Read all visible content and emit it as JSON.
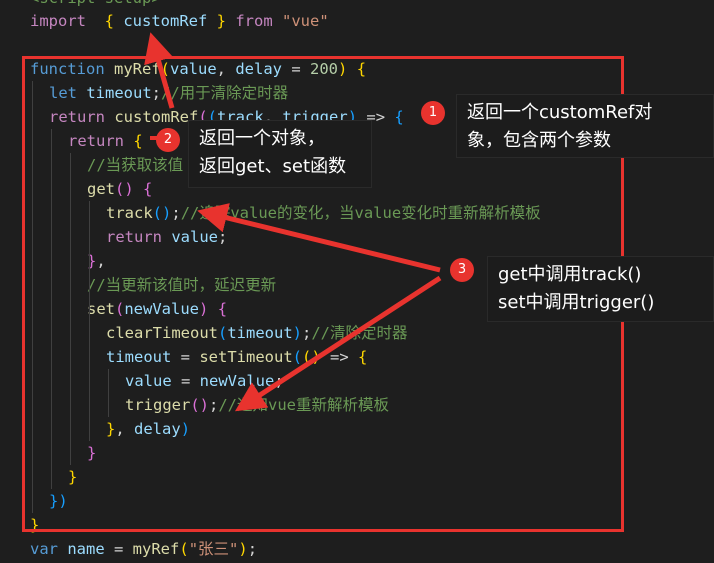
{
  "code": {
    "lines": [
      {
        "tokens": [
          [
            "cm",
            "<script setup>"
          ]
        ]
      },
      {
        "tokens": [
          [
            "kw2",
            "import"
          ],
          [
            "",
            "  "
          ],
          [
            "br1",
            "{"
          ],
          [
            "",
            ""
          ],
          [
            "var",
            " customRef"
          ],
          [
            "",
            ""
          ],
          [
            "br1",
            " }"
          ],
          [
            "kw2",
            " from"
          ],
          [
            "str",
            " \"vue\""
          ]
        ]
      },
      {
        "tokens": []
      },
      {
        "tokens": [
          [
            "kw",
            "function"
          ],
          [
            "fn",
            " myRef"
          ],
          [
            "br1",
            "("
          ],
          [
            "var",
            "value"
          ],
          [
            "",
            ", "
          ],
          [
            "var",
            "delay"
          ],
          [
            "",
            " = "
          ],
          [
            "num",
            "200"
          ],
          [
            "br1",
            ")"
          ],
          [
            "",
            " "
          ],
          [
            "br1",
            "{"
          ]
        ]
      },
      {
        "tokens": [
          [
            "kw",
            "let"
          ],
          [
            "var",
            " timeout"
          ],
          [
            "",
            ";"
          ],
          [
            "cm",
            "//用于清除定时器"
          ]
        ]
      },
      {
        "tokens": [
          [
            "kw2",
            "return"
          ],
          [
            "fn",
            " customRef"
          ],
          [
            "br2",
            "("
          ],
          [
            "br3",
            "("
          ],
          [
            "var",
            "track"
          ],
          [
            "",
            ", "
          ],
          [
            "var",
            "trigger"
          ],
          [
            "br3",
            ")"
          ],
          [
            "",
            " => "
          ],
          [
            "br3",
            "{"
          ]
        ]
      },
      {
        "tokens": [
          [
            "kw2",
            "return"
          ],
          [
            "",
            " "
          ],
          [
            "br1",
            "{"
          ]
        ]
      },
      {
        "tokens": [
          [
            "cm",
            "//当获取该值"
          ]
        ]
      },
      {
        "tokens": [
          [
            "fn",
            "get"
          ],
          [
            "br2",
            "()"
          ],
          [
            "",
            " "
          ],
          [
            "br2",
            "{"
          ]
        ]
      },
      {
        "tokens": [
          [
            "fn",
            "track"
          ],
          [
            "br3",
            "()"
          ],
          [
            "",
            ";"
          ],
          [
            "cm",
            "//追踪value的变化，当value变化时重新解析模板"
          ]
        ]
      },
      {
        "tokens": [
          [
            "kw2",
            "return"
          ],
          [
            "var",
            " value"
          ],
          [
            "",
            ";"
          ]
        ]
      },
      {
        "tokens": [
          [
            "br2",
            "}"
          ],
          [
            "",
            ","
          ]
        ]
      },
      {
        "tokens": [
          [
            "cm",
            "//当更新该值时，延迟更新"
          ]
        ]
      },
      {
        "tokens": [
          [
            "fn",
            "set"
          ],
          [
            "br2",
            "("
          ],
          [
            "var",
            "newValue"
          ],
          [
            "br2",
            ")"
          ],
          [
            "",
            " "
          ],
          [
            "br2",
            "{"
          ]
        ]
      },
      {
        "tokens": [
          [
            "fn",
            "clearTimeout"
          ],
          [
            "br3",
            "("
          ],
          [
            "var",
            "timeout"
          ],
          [
            "br3",
            ")"
          ],
          [
            "",
            ";"
          ],
          [
            "cm",
            "//清除定时器"
          ]
        ]
      },
      {
        "tokens": [
          [
            "var",
            "timeout"
          ],
          [
            "",
            " = "
          ],
          [
            "fn",
            "setTimeout"
          ],
          [
            "br3",
            "("
          ],
          [
            "br1",
            "()"
          ],
          [
            "",
            " => "
          ],
          [
            "br1",
            "{"
          ]
        ]
      },
      {
        "tokens": [
          [
            "var",
            "value"
          ],
          [
            "",
            " = "
          ],
          [
            "var",
            "newValue"
          ],
          [
            "",
            ";"
          ]
        ]
      },
      {
        "tokens": [
          [
            "fn",
            "trigger"
          ],
          [
            "br2",
            "()"
          ],
          [
            "",
            ";"
          ],
          [
            "cm",
            "//通知vue重新解析模板"
          ]
        ]
      },
      {
        "tokens": [
          [
            "br1",
            "}"
          ],
          [
            "",
            ", "
          ],
          [
            "var",
            "delay"
          ],
          [
            "br3",
            ")"
          ]
        ]
      },
      {
        "tokens": [
          [
            "br2",
            "}"
          ]
        ]
      },
      {
        "tokens": [
          [
            "br1",
            "}"
          ]
        ]
      },
      {
        "tokens": [
          [
            "br3",
            "})"
          ]
        ]
      },
      {
        "tokens": [
          [
            "br1",
            "}"
          ]
        ]
      },
      {
        "tokens": [
          [
            "kw",
            "var"
          ],
          [
            "var",
            " name"
          ],
          [
            "",
            " = "
          ],
          [
            "fn",
            "myRef"
          ],
          [
            "br1",
            "("
          ],
          [
            "str",
            "\"张三\""
          ],
          [
            "br1",
            ")"
          ],
          [
            "",
            ";"
          ]
        ]
      }
    ]
  },
  "callouts": {
    "c1": {
      "badge": "1",
      "lines": [
        "返回一个customRef对",
        "象，包含两个参数"
      ]
    },
    "c2": {
      "badge": "2",
      "lines": [
        "返回一个对象，",
        "返回get、set函数"
      ]
    },
    "c3": {
      "badge": "3",
      "lines": [
        "get中调用track()",
        "set中调用trigger()"
      ]
    }
  },
  "colors": {
    "annotation": "#e8332e",
    "background": "#1e1e1e"
  }
}
